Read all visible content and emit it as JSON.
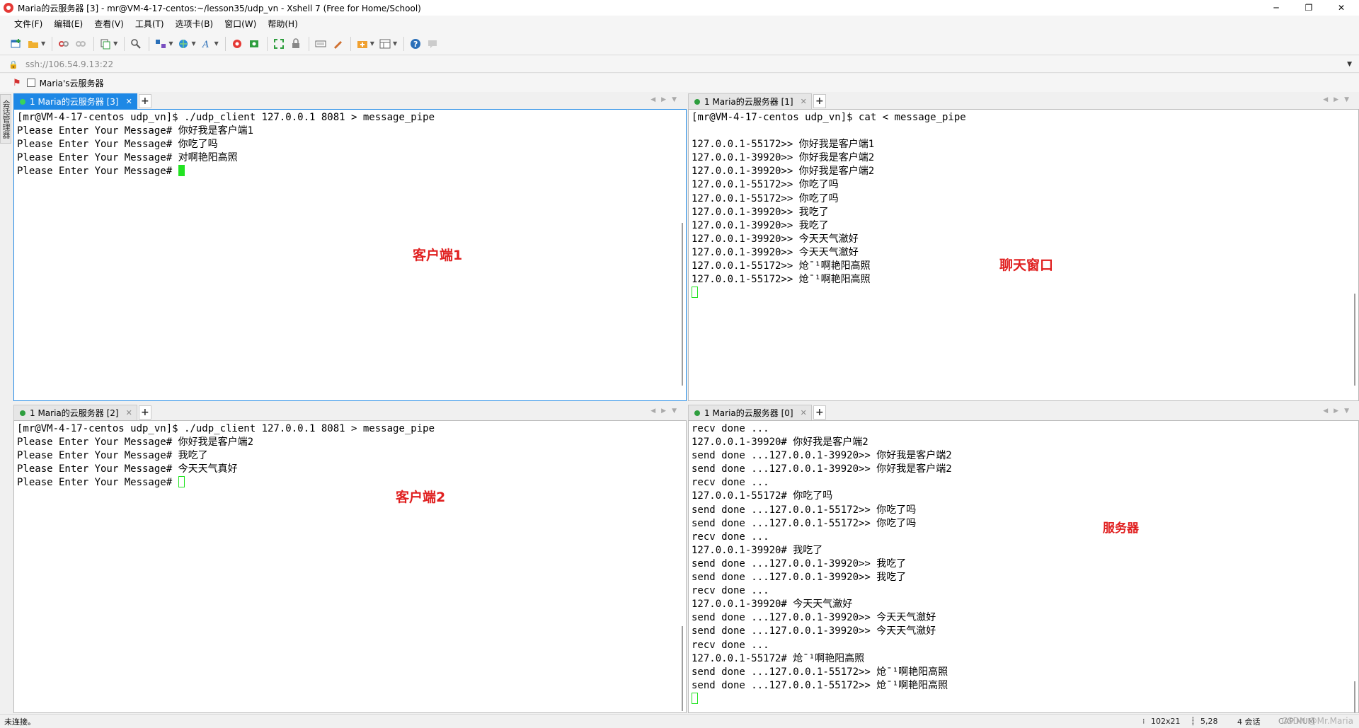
{
  "window": {
    "title": "Maria的云服务器 [3] - mr@VM-4-17-centos:~/lesson35/udp_vn - Xshell 7 (Free for Home/School)",
    "controls": [
      "─",
      "❐",
      "✕"
    ]
  },
  "menu": [
    "文件(F)",
    "编辑(E)",
    "查看(V)",
    "工具(T)",
    "选项卡(B)",
    "窗口(W)",
    "帮助(H)"
  ],
  "address": {
    "value": "ssh://106.54.9.13:22"
  },
  "bookmarks": {
    "item": "Maria's云服务器"
  },
  "sidetab": {
    "label": "会话管理器"
  },
  "panes": {
    "top_left": {
      "tab_label": "1 Maria的云服务器 [3]",
      "annotation": "客户端1",
      "lines": [
        "[mr@VM-4-17-centos udp_vn]$ ./udp_client 127.0.0.1 8081 > message_pipe",
        "Please Enter Your Message# 你好我是客户端1",
        "Please Enter Your Message# 你吃了吗",
        "Please Enter Your Message# 对啊艳阳高照",
        "Please Enter Your Message# "
      ]
    },
    "top_right": {
      "tab_label": "1 Maria的云服务器 [1]",
      "annotation": "聊天窗口",
      "lines": [
        "[mr@VM-4-17-centos udp_vn]$ cat < message_pipe",
        "",
        "127.0.0.1-55172>> 你好我是客户端1",
        "127.0.0.1-39920>> 你好我是客户端2",
        "127.0.0.1-39920>> 你好我是客户端2",
        "127.0.0.1-55172>> 你吃了吗",
        "127.0.0.1-55172>> 你吃了吗",
        "127.0.0.1-39920>> 我吃了",
        "127.0.0.1-39920>> 我吃了",
        "127.0.0.1-39920>> 今天天气瀲好",
        "127.0.0.1-39920>> 今天天气瀲好",
        "127.0.0.1-55172>> 炝¯¹啊艳阳高照",
        "127.0.0.1-55172>> 炝¯¹啊艳阳高照"
      ]
    },
    "bottom_left": {
      "tab_label": "1 Maria的云服务器 [2]",
      "annotation": "客户端2",
      "lines": [
        "[mr@VM-4-17-centos udp_vn]$ ./udp_client 127.0.0.1 8081 > message_pipe",
        "Please Enter Your Message# 你好我是客户端2",
        "Please Enter Your Message# 我吃了",
        "Please Enter Your Message# 今天天气真好",
        "Please Enter Your Message# "
      ]
    },
    "bottom_right": {
      "tab_label": "1 Maria的云服务器 [0]",
      "annotation": "服务器",
      "lines": [
        "recv done ...",
        "127.0.0.1-39920# 你好我是客户端2",
        "send done ...127.0.0.1-39920>> 你好我是客户端2",
        "send done ...127.0.0.1-39920>> 你好我是客户端2",
        "recv done ...",
        "127.0.0.1-55172# 你吃了吗",
        "send done ...127.0.0.1-55172>> 你吃了吗",
        "send done ...127.0.0.1-55172>> 你吃了吗",
        "recv done ...",
        "127.0.0.1-39920# 我吃了",
        "send done ...127.0.0.1-39920>> 我吃了",
        "send done ...127.0.0.1-39920>> 我吃了",
        "recv done ...",
        "127.0.0.1-39920# 今天天气瀲好",
        "send done ...127.0.0.1-39920>> 今天天气瀲好",
        "send done ...127.0.0.1-39920>> 今天天气瀲好",
        "recv done ...",
        "127.0.0.1-55172# 炝¯¹啊艳阳高照",
        "send done ...127.0.0.1-55172>> 炝¯¹啊艳阳高照",
        "send done ...127.0.0.1-55172>> 炝¯¹啊艳阳高照"
      ]
    }
  },
  "status": {
    "left": "未连接。",
    "size": "102x21",
    "pos": "5,28",
    "sessions": "4 会话",
    "caps": "CAP  NUM"
  },
  "watermark": "CSDN @Mr.Maria",
  "colors": {
    "accent": "#1e88e5",
    "cursor": "#22e322",
    "annotation": "#e02020"
  }
}
